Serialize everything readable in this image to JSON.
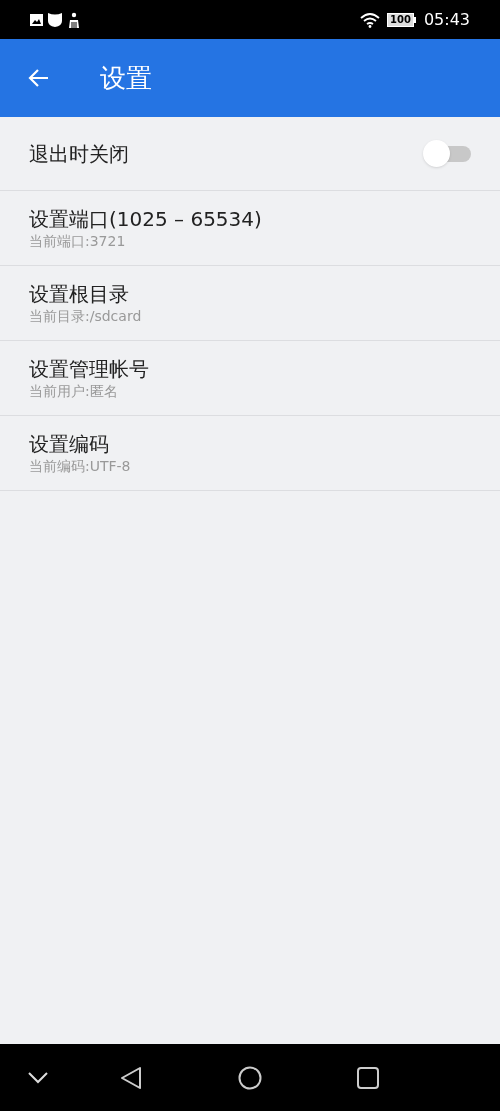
{
  "status_bar": {
    "battery": "100",
    "time": "05:43"
  },
  "app_bar": {
    "title": "设置"
  },
  "settings": [
    {
      "kind": "switch",
      "title": "退出时关闭",
      "on": false
    },
    {
      "kind": "entry",
      "title": "设置端口(1025 – 65534)",
      "subtitle": "当前端口:3721"
    },
    {
      "kind": "entry",
      "title": "设置根目录",
      "subtitle": "当前目录:/sdcard"
    },
    {
      "kind": "entry",
      "title": "设置管理帐号",
      "subtitle": "当前用户:匿名"
    },
    {
      "kind": "entry",
      "title": "设置编码",
      "subtitle": "当前编码:UTF-8"
    }
  ]
}
